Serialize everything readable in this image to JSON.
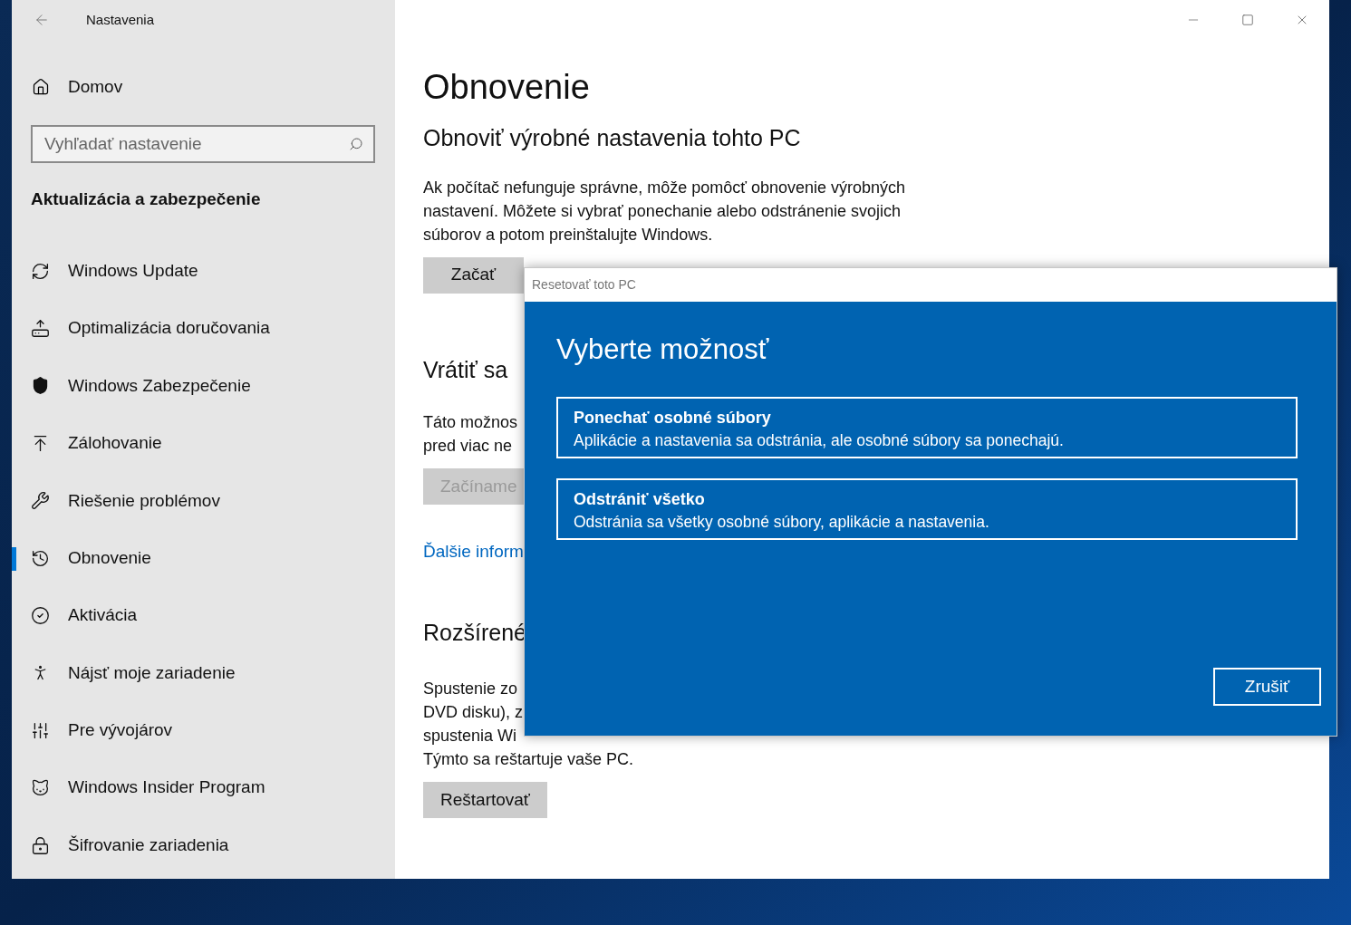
{
  "window": {
    "title": "Nastavenia"
  },
  "sidebar": {
    "home": "Domov",
    "search": {
      "placeholder": "Vyhľadať nastavenie"
    },
    "section": "Aktualizácia a zabezpečenie",
    "items": [
      {
        "label": "Windows Update",
        "selected": false
      },
      {
        "label": "Optimalizácia doručovania",
        "selected": false
      },
      {
        "label": "Windows Zabezpečenie",
        "selected": false
      },
      {
        "label": "Zálohovanie",
        "selected": false
      },
      {
        "label": "Riešenie problémov",
        "selected": false
      },
      {
        "label": "Obnovenie",
        "selected": true
      },
      {
        "label": "Aktivácia",
        "selected": false
      },
      {
        "label": "Nájsť moje zariadenie",
        "selected": false
      },
      {
        "label": "Pre vývojárov",
        "selected": false
      },
      {
        "label": "Windows Insider Program",
        "selected": false
      },
      {
        "label": "Šifrovanie zariadenia",
        "selected": false
      }
    ]
  },
  "main": {
    "title": "Obnovenie",
    "reset": {
      "heading": "Obnoviť výrobné nastavenia tohto PC",
      "lines": [
        "Ak počítač nefunguje správne, môže pomôcť obnovenie výrobných",
        "nastavení. Môžete si vybrať ponechanie alebo odstránenie svojich",
        "súborov a potom preinštalujte Windows."
      ],
      "button": {
        "label": "Začať",
        "disabled": false
      }
    },
    "go_back": {
      "heading": "Vrátiť sa",
      "lines": [
        "Táto možnos",
        "pred viac ne"
      ],
      "button": {
        "label": "Začíname",
        "disabled": true
      },
      "link": "Ďalšie inform"
    },
    "advanced": {
      "heading": "Rozšírené",
      "lines": [
        "Spustenie zo",
        "DVD disku), z",
        "spustenia Wi",
        "Týmto sa reštartuje vaše PC."
      ],
      "button": {
        "label": "Reštartovať",
        "disabled": false
      }
    }
  },
  "dialog": {
    "title": "Resetovať toto PC",
    "heading": "Vyberte možnosť",
    "options": [
      {
        "title": "Ponechať osobné súbory",
        "description": "Aplikácie a nastavenia sa odstránia, ale osobné súbory sa ponechajú."
      },
      {
        "title": "Odstrániť všetko",
        "description": "Odstránia sa všetky osobné súbory, aplikácie a nastavenia."
      }
    ],
    "cancel": "Zrušiť"
  }
}
